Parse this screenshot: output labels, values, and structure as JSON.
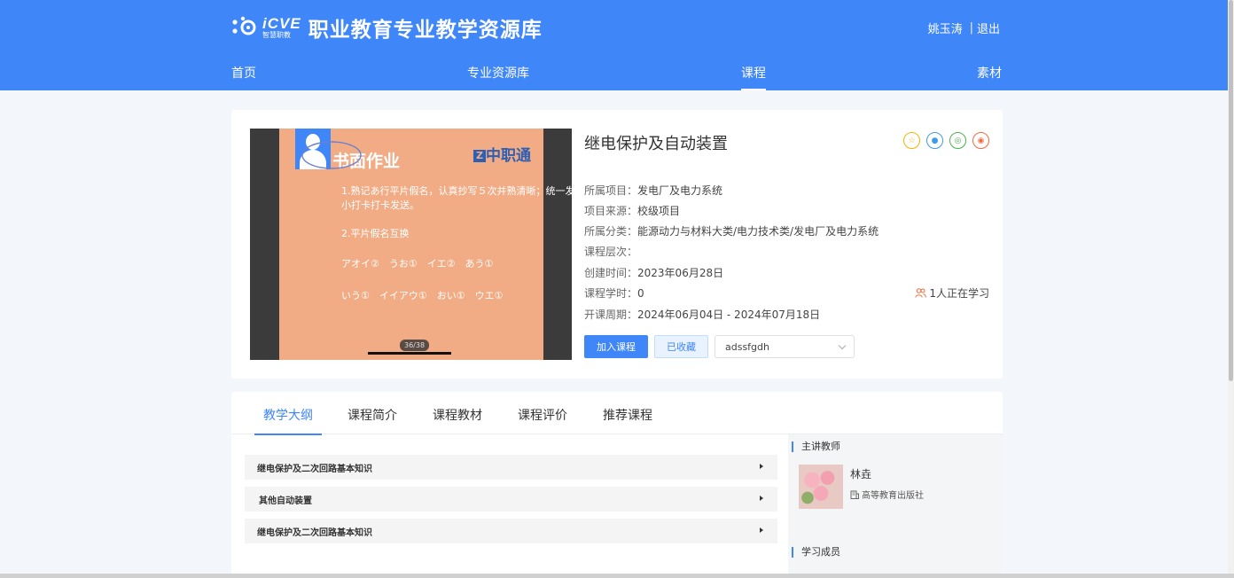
{
  "header": {
    "logo_brand": "iCVE",
    "logo_sub": "智慧职教",
    "site_title": "职业教育专业教学资源库",
    "user_name": "姚玉涛",
    "separator": "|",
    "logout_label": "退出",
    "nav": [
      "首页",
      "专业资源库",
      "课程",
      "素材"
    ],
    "active_nav": "课程"
  },
  "course": {
    "title": "继电保护及自动装置",
    "cover": {
      "slide_title": "书面作业",
      "slide_brand": "中职通",
      "slide_lines": [
        "1.熟记あ行平片假名，认真抄写５次并熟清晰；统一发到",
        "小打卡打卡发送。",
        "2.平片假名互换",
        "アオイ②　うお①　イエ②　あう①",
        "いう①　イイアウ①　おい①　ウエ①"
      ],
      "page_indicator": "36/38"
    },
    "meta": [
      {
        "label": "所属项目：",
        "value": "发电厂及电力系统"
      },
      {
        "label": "项目来源：",
        "value": "校级项目"
      },
      {
        "label": "所属分类：",
        "value": "能源动力与材料大类/电力技术类/发电厂及电力系统"
      },
      {
        "label": "课程层次：",
        "value": ""
      },
      {
        "label": "创建时间：",
        "value": "2023年06月28日"
      },
      {
        "label": "课程学时：",
        "value": "0"
      },
      {
        "label": "开课周期：",
        "value": "2024年06月04日 - 2024年07月18日"
      }
    ],
    "learning_count": "1人正在学习",
    "join_label": "加入课程",
    "favorited_label": "已收藏",
    "select_value": "adssfgdh",
    "share_icons": [
      "qzone-icon",
      "qq-icon",
      "wechat-icon",
      "weibo-icon"
    ],
    "colors": {
      "accent": "#3f86f8",
      "qzone": "#f5b400",
      "qq": "#3d9be9",
      "wechat": "#4caf50",
      "weibo": "#f06a3a"
    }
  },
  "tabs": [
    "教学大纲",
    "课程简介",
    "课程教材",
    "课程评价",
    "推荐课程"
  ],
  "active_tab": "教学大纲",
  "chapters": [
    "继电保护及二次回路基本知识",
    "其他自动装置",
    "继电保护及二次回路基本知识"
  ],
  "sidebar": {
    "teacher_heading": "主讲教师",
    "teacher_name": "林垚",
    "teacher_org": "高等教育出版社",
    "members_heading": "学习成员"
  }
}
